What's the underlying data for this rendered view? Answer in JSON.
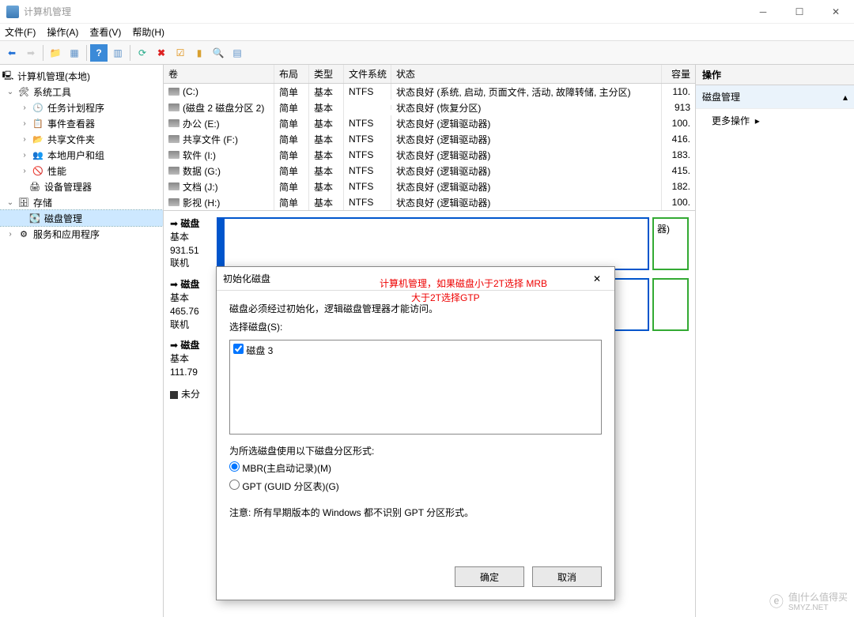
{
  "window": {
    "title": "计算机管理"
  },
  "menu": {
    "file": "文件(F)",
    "action": "操作(A)",
    "view": "查看(V)",
    "help": "帮助(H)"
  },
  "tree": {
    "root": "计算机管理(本地)",
    "system_tools": "系统工具",
    "task_scheduler": "任务计划程序",
    "event_viewer": "事件查看器",
    "shared_folders": "共享文件夹",
    "local_users": "本地用户和组",
    "performance": "性能",
    "device_manager": "设备管理器",
    "storage": "存储",
    "disk_management": "磁盘管理",
    "services_apps": "服务和应用程序"
  },
  "vol_header": {
    "volume": "卷",
    "layout": "布局",
    "type": "类型",
    "fs": "文件系统",
    "status": "状态",
    "capacity": "容量"
  },
  "volumes": [
    {
      "name": "(C:)",
      "layout": "简单",
      "type": "基本",
      "fs": "NTFS",
      "status": "状态良好 (系统, 启动, 页面文件, 活动, 故障转储, 主分区)",
      "cap": "110."
    },
    {
      "name": "(磁盘 2 磁盘分区 2)",
      "layout": "简单",
      "type": "基本",
      "fs": "",
      "status": "状态良好 (恢复分区)",
      "cap": "913"
    },
    {
      "name": "办公 (E:)",
      "layout": "简单",
      "type": "基本",
      "fs": "NTFS",
      "status": "状态良好 (逻辑驱动器)",
      "cap": "100."
    },
    {
      "name": "共享文件 (F:)",
      "layout": "简单",
      "type": "基本",
      "fs": "NTFS",
      "status": "状态良好 (逻辑驱动器)",
      "cap": "416."
    },
    {
      "name": "软件 (I:)",
      "layout": "简单",
      "type": "基本",
      "fs": "NTFS",
      "status": "状态良好 (逻辑驱动器)",
      "cap": "183."
    },
    {
      "name": "数据 (G:)",
      "layout": "简单",
      "type": "基本",
      "fs": "NTFS",
      "status": "状态良好 (逻辑驱动器)",
      "cap": "415."
    },
    {
      "name": "文档 (J:)",
      "layout": "简单",
      "type": "基本",
      "fs": "NTFS",
      "status": "状态良好 (逻辑驱动器)",
      "cap": "182."
    },
    {
      "name": "影视 (H:)",
      "layout": "简单",
      "type": "基本",
      "fs": "NTFS",
      "status": "状态良好 (逻辑驱动器)",
      "cap": "100."
    }
  ],
  "disk_panel": {
    "disk0": {
      "title": "磁盘",
      "kind": "基本",
      "size": "931.51",
      "state": "联机"
    },
    "disk1": {
      "title": "磁盘",
      "kind": "基本",
      "size": "465.76",
      "state": "联机"
    },
    "disk2": {
      "title": "磁盘",
      "kind": "基本",
      "size": "111.79"
    },
    "part_suffix": "器)",
    "legend_unalloc": "未分"
  },
  "right": {
    "title": "操作",
    "section": "磁盘管理",
    "more": "更多操作"
  },
  "dialog": {
    "title": "初始化磁盘",
    "desc": "磁盘必须经过初始化，逻辑磁盘管理器才能访问。",
    "select_label": "选择磁盘(S):",
    "disk_item": "磁盘 3",
    "style_label": "为所选磁盘使用以下磁盘分区形式:",
    "mbr": "MBR(主启动记录)(M)",
    "gpt": "GPT (GUID 分区表)(G)",
    "note": "注意: 所有早期版本的 Windows 都不识别 GPT 分区形式。",
    "ok": "确定",
    "cancel": "取消"
  },
  "annotation": {
    "line1": "计算机管理，如果磁盘小于2T选择 MRB",
    "line2": "大于2T选择GTP"
  },
  "watermark": {
    "text1": "值|什么值得买",
    "text2": "SMYZ.NET"
  }
}
